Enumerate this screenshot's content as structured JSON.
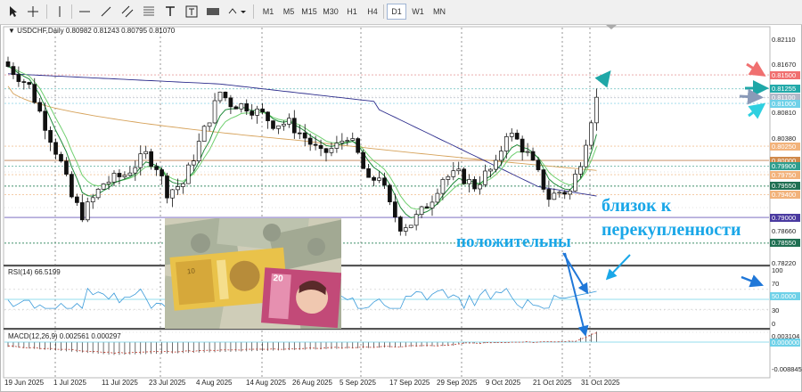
{
  "toolbar": {
    "timeframes": [
      "M1",
      "M5",
      "M15",
      "M30",
      "H1",
      "H4",
      "D1",
      "W1",
      "MN"
    ],
    "active_timeframe": "D1"
  },
  "chart": {
    "symbol_label": "USDCHF,Daily",
    "ohlc": "0.80982 0.81243 0.80795 0.81070",
    "price_scale": [
      "0.82110",
      "0.81670",
      "0.81250",
      "0.80810",
      "0.80380",
      "0.79520",
      "0.78660",
      "0.78220"
    ],
    "price_tags": [
      {
        "label": "0.81500",
        "color": "#f07070",
        "text_color": "#ffffff"
      },
      {
        "label": "0.81255",
        "color": "#22a9a9",
        "text_color": "#ffffff"
      },
      {
        "label": "0.81100",
        "color": "#b0b8c8",
        "text_color": "#ffffff"
      },
      {
        "label": "0.81000",
        "color": "#6fd1e8",
        "text_color": "#ffffff"
      },
      {
        "label": "0.80250",
        "color": "#f2b27a",
        "text_color": "#ffffff"
      },
      {
        "label": "0.80000",
        "color": "#d08a4c",
        "text_color": "#ffffff"
      },
      {
        "label": "0.79900",
        "color": "#2f9e8e",
        "text_color": "#ffffff"
      },
      {
        "label": "0.79750",
        "color": "#f2b27a",
        "text_color": "#ffffff"
      },
      {
        "label": "0.79550",
        "color": "#1f6f52",
        "text_color": "#ffffff"
      },
      {
        "label": "0.79400",
        "color": "#f2b27a",
        "text_color": "#ffffff"
      },
      {
        "label": "0.79000",
        "color": "#4a3aa0",
        "text_color": "#ffffff"
      },
      {
        "label": "0.78550",
        "color": "#1f6f52",
        "text_color": "#ffffff"
      }
    ],
    "colors": {
      "bull_candle": "#ffffff",
      "bear_candle": "#111111",
      "ma_fast": "#1f8a3a",
      "ma_mid": "#6fcf6f",
      "ma_slow": "#2c2c8c",
      "ma_200": "#d6a25a",
      "rsi_line": "#3a9ad9",
      "arrow_red": "#f07070",
      "arrow_teal": "#1fa7a7",
      "arrow_cyan": "#2fd0e0",
      "annotation_text": "#1aa7e8"
    }
  },
  "rsi": {
    "label": "RSI(14) 66.5199",
    "scale": [
      "100",
      "70",
      "30",
      "0"
    ],
    "tag": {
      "label": "50.0000",
      "color": "#6fd1e8"
    }
  },
  "macd": {
    "label": "MACD(12,26,9) 0.002561 0.000297",
    "scale": [
      "0.003104",
      "-0.008845"
    ],
    "tag": {
      "label": "0.000000",
      "color": "#6fd1e8"
    }
  },
  "dates": [
    "19 Jun 2025",
    "1 Jul 2025",
    "11 Jul 2025",
    "23 Jul 2025",
    "4 Aug 2025",
    "14 Aug 2025",
    "26 Aug 2025",
    "5 Sep 2025",
    "17 Sep 2025",
    "29 Sep 2025",
    "9 Oct 2025",
    "21 Oct 2025",
    "31 Oct 2025"
  ],
  "annotations": {
    "overbought": [
      "близок к",
      "перекупленности"
    ],
    "positive": "положительны"
  }
}
